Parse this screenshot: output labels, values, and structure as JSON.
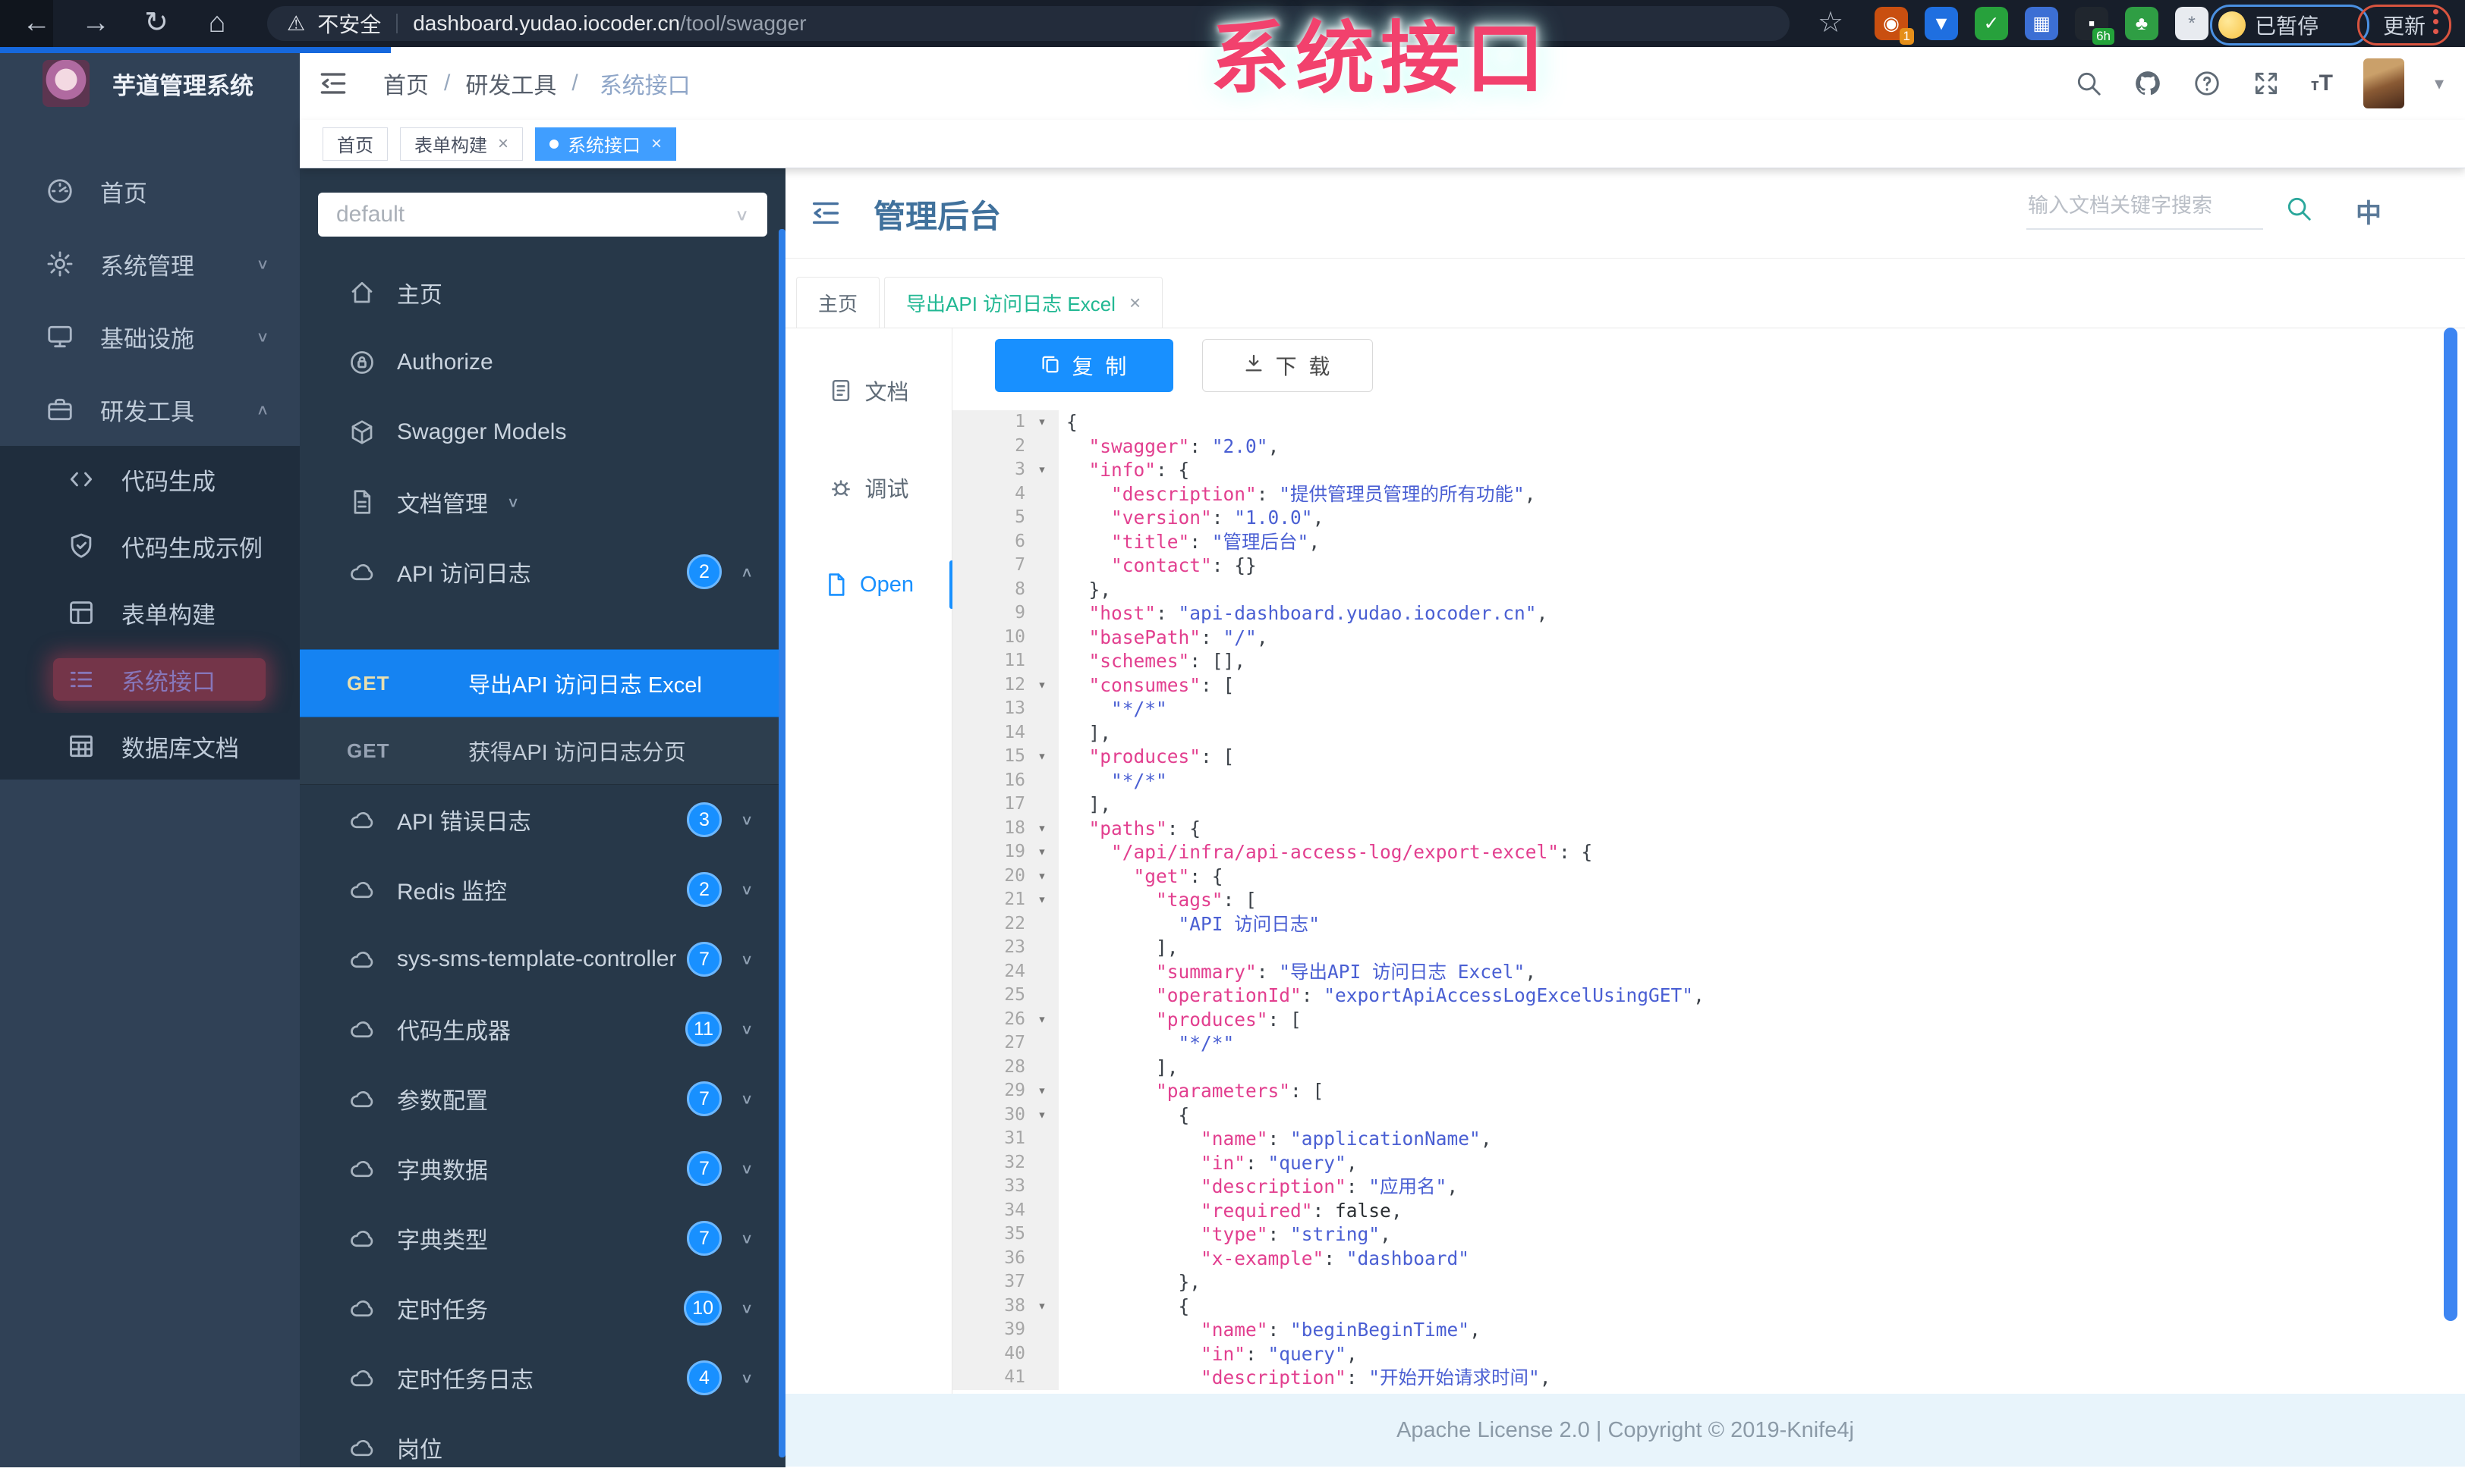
{
  "browser": {
    "security_label": "不安全",
    "url_host": "dashboard.yudao.iocoder.cn",
    "url_path": "/tool/swagger",
    "paused_label": "已暂停",
    "update_label": "更新",
    "extensions": [
      {
        "name": "circle-orange",
        "glyph": "◉",
        "bg": "#c94f10",
        "badge": "1",
        "badge_bg": "#e58f1a"
      },
      {
        "name": "pin-blue",
        "glyph": "▼",
        "bg": "#1f6fe0"
      },
      {
        "name": "check-green",
        "glyph": "✓",
        "bg": "#27a13c"
      },
      {
        "name": "grid-blue",
        "glyph": "▦",
        "bg": "#3c6fd4"
      },
      {
        "name": "timer-dark",
        "glyph": "▪",
        "bg": "#20262e",
        "badge": "6h",
        "badge_bg": "#23a33a"
      },
      {
        "name": "leaf-green",
        "glyph": "♣",
        "bg": "#2f9e44"
      },
      {
        "name": "star-light",
        "glyph": "*",
        "bg": "#e8ebf0",
        "fg": "#7c8694"
      }
    ]
  },
  "watermark": "系统接口",
  "sidebar": {
    "logo_title": "芋道管理系统",
    "items": [
      {
        "key": "home",
        "icon": "dashboard-icon",
        "label": "首页"
      },
      {
        "key": "system",
        "icon": "gear-icon",
        "label": "系统管理",
        "chevron": "down"
      },
      {
        "key": "infra",
        "icon": "infra-icon",
        "label": "基础设施",
        "chevron": "down"
      },
      {
        "key": "devtools",
        "icon": "tools-icon",
        "label": "研发工具",
        "chevron": "up"
      },
      {
        "key": "codegen",
        "icon": "code-icon",
        "label": "代码生成",
        "sub": true
      },
      {
        "key": "codegen-demo",
        "icon": "shield-icon",
        "label": "代码生成示例",
        "sub": true
      },
      {
        "key": "form-builder",
        "icon": "form-icon",
        "label": "表单构建",
        "sub": true
      },
      {
        "key": "system-api",
        "icon": "api-icon",
        "label": "系统接口",
        "sub": true,
        "active": true,
        "annotated": true
      },
      {
        "key": "db-doc",
        "icon": "db-icon",
        "label": "数据库文档",
        "sub": true
      }
    ]
  },
  "header": {
    "breadcrumb": [
      {
        "label": "首页"
      },
      {
        "label": "研发工具"
      },
      {
        "label": "系统接口",
        "current": true
      }
    ]
  },
  "tags": [
    {
      "key": "home",
      "label": "首页"
    },
    {
      "key": "form-builder",
      "label": "表单构建",
      "closable": true
    },
    {
      "key": "system-api",
      "label": "系统接口",
      "closable": true,
      "active": true
    }
  ],
  "swagger_panel": {
    "group_value": "default",
    "menu": [
      {
        "type": "item",
        "key": "home",
        "icon": "home-icon",
        "label": "主页"
      },
      {
        "type": "item",
        "key": "authorize",
        "icon": "lock-icon",
        "label": "Authorize"
      },
      {
        "type": "item",
        "key": "swagger-models",
        "icon": "models-icon",
        "label": "Swagger Models"
      },
      {
        "type": "item",
        "key": "doc-manage",
        "icon": "filedoc-icon",
        "label": "文档管理",
        "chevron": "down"
      },
      {
        "type": "item",
        "key": "api-access-log",
        "icon": "cloud-icon",
        "label": "API 访问日志",
        "badge": "2",
        "chevron": "up"
      },
      {
        "type": "api",
        "key": "export-excel",
        "method": "GET",
        "label": "导出API 访问日志 Excel",
        "active": true
      },
      {
        "type": "api",
        "key": "access-log-page",
        "method": "GET",
        "label": "获得API 访问日志分页"
      },
      {
        "type": "item",
        "key": "api-error-log",
        "icon": "cloud-icon",
        "label": "API 错误日志",
        "badge": "3",
        "chevron": "down"
      },
      {
        "type": "item",
        "key": "redis-monitor",
        "icon": "cloud-icon",
        "label": "Redis 监控",
        "badge": "2",
        "chevron": "down"
      },
      {
        "type": "item",
        "key": "sms-template",
        "icon": "cloud-icon",
        "label": "sys-sms-template-controller",
        "badge": "7",
        "chevron": "down"
      },
      {
        "type": "item",
        "key": "code-generator",
        "icon": "cloud-icon",
        "label": "代码生成器",
        "badge": "11",
        "chevron": "down"
      },
      {
        "type": "item",
        "key": "param-config",
        "icon": "cloud-icon",
        "label": "参数配置",
        "badge": "7",
        "chevron": "down"
      },
      {
        "type": "item",
        "key": "dict-data",
        "icon": "cloud-icon",
        "label": "字典数据",
        "badge": "7",
        "chevron": "down"
      },
      {
        "type": "item",
        "key": "dict-type",
        "icon": "cloud-icon",
        "label": "字典类型",
        "badge": "7",
        "chevron": "down"
      },
      {
        "type": "item",
        "key": "job",
        "icon": "cloud-icon",
        "label": "定时任务",
        "badge": "10",
        "chevron": "down"
      },
      {
        "type": "item",
        "key": "job-log",
        "icon": "cloud-icon",
        "label": "定时任务日志",
        "badge": "4",
        "chevron": "down"
      },
      {
        "type": "item",
        "key": "post",
        "icon": "cloud-icon",
        "label": "岗位",
        "partial": true
      }
    ]
  },
  "doc": {
    "title": "管理后台",
    "search_placeholder": "输入文档关键字搜索",
    "lang_icon_label": "中",
    "tabs": [
      {
        "key": "home",
        "label": "主页"
      },
      {
        "key": "export-excel",
        "label": "导出API 访问日志 Excel",
        "closable": true,
        "active": true
      }
    ],
    "subnav": [
      {
        "key": "document",
        "icon": "doc-icon",
        "label": "文档"
      },
      {
        "key": "debug",
        "icon": "bug-icon",
        "label": "调试"
      },
      {
        "key": "open",
        "icon": "file-icon",
        "label": "Open",
        "active": true
      }
    ],
    "toolbar": {
      "copy": "复 制",
      "download": "下 载"
    },
    "footer": "Apache License 2.0 | Copyright © 2019-Knife4j"
  },
  "code": {
    "lines": [
      {
        "n": 1,
        "f": 1,
        "t": [
          [
            "p",
            "{"
          ]
        ]
      },
      {
        "n": 2,
        "t": [
          [
            "p",
            "  "
          ],
          [
            "k",
            "\"swagger\""
          ],
          [
            "p",
            ": "
          ],
          [
            "s",
            "\"2.0\""
          ],
          [
            "p",
            ","
          ]
        ]
      },
      {
        "n": 3,
        "f": 1,
        "t": [
          [
            "p",
            "  "
          ],
          [
            "k",
            "\"info\""
          ],
          [
            "p",
            ": {"
          ]
        ]
      },
      {
        "n": 4,
        "t": [
          [
            "p",
            "    "
          ],
          [
            "k",
            "\"description\""
          ],
          [
            "p",
            ": "
          ],
          [
            "s",
            "\"提供管理员管理的所有功能\""
          ],
          [
            "p",
            ","
          ]
        ]
      },
      {
        "n": 5,
        "t": [
          [
            "p",
            "    "
          ],
          [
            "k",
            "\"version\""
          ],
          [
            "p",
            ": "
          ],
          [
            "s",
            "\"1.0.0\""
          ],
          [
            "p",
            ","
          ]
        ]
      },
      {
        "n": 6,
        "t": [
          [
            "p",
            "    "
          ],
          [
            "k",
            "\"title\""
          ],
          [
            "p",
            ": "
          ],
          [
            "s",
            "\"管理后台\""
          ],
          [
            "p",
            ","
          ]
        ]
      },
      {
        "n": 7,
        "t": [
          [
            "p",
            "    "
          ],
          [
            "k",
            "\"contact\""
          ],
          [
            "p",
            ": {}"
          ]
        ]
      },
      {
        "n": 8,
        "t": [
          [
            "p",
            "  },"
          ]
        ]
      },
      {
        "n": 9,
        "t": [
          [
            "p",
            "  "
          ],
          [
            "k",
            "\"host\""
          ],
          [
            "p",
            ": "
          ],
          [
            "s",
            "\"api-dashboard.yudao.iocoder.cn\""
          ],
          [
            "p",
            ","
          ]
        ]
      },
      {
        "n": 10,
        "t": [
          [
            "p",
            "  "
          ],
          [
            "k",
            "\"basePath\""
          ],
          [
            "p",
            ": "
          ],
          [
            "s",
            "\"/\""
          ],
          [
            "p",
            ","
          ]
        ]
      },
      {
        "n": 11,
        "t": [
          [
            "p",
            "  "
          ],
          [
            "k",
            "\"schemes\""
          ],
          [
            "p",
            ": [],"
          ]
        ]
      },
      {
        "n": 12,
        "f": 1,
        "t": [
          [
            "p",
            "  "
          ],
          [
            "k",
            "\"consumes\""
          ],
          [
            "p",
            ": ["
          ]
        ]
      },
      {
        "n": 13,
        "t": [
          [
            "p",
            "    "
          ],
          [
            "s",
            "\"*/*\""
          ]
        ]
      },
      {
        "n": 14,
        "t": [
          [
            "p",
            "  ],"
          ]
        ]
      },
      {
        "n": 15,
        "f": 1,
        "t": [
          [
            "p",
            "  "
          ],
          [
            "k",
            "\"produces\""
          ],
          [
            "p",
            ": ["
          ]
        ]
      },
      {
        "n": 16,
        "t": [
          [
            "p",
            "    "
          ],
          [
            "s",
            "\"*/*\""
          ]
        ]
      },
      {
        "n": 17,
        "t": [
          [
            "p",
            "  ],"
          ]
        ]
      },
      {
        "n": 18,
        "f": 1,
        "t": [
          [
            "p",
            "  "
          ],
          [
            "k",
            "\"paths\""
          ],
          [
            "p",
            ": {"
          ]
        ]
      },
      {
        "n": 19,
        "f": 1,
        "t": [
          [
            "p",
            "    "
          ],
          [
            "k",
            "\"/api/infra/api-access-log/export-excel\""
          ],
          [
            "p",
            ": {"
          ]
        ]
      },
      {
        "n": 20,
        "f": 1,
        "t": [
          [
            "p",
            "      "
          ],
          [
            "k",
            "\"get\""
          ],
          [
            "p",
            ": {"
          ]
        ]
      },
      {
        "n": 21,
        "f": 1,
        "t": [
          [
            "p",
            "        "
          ],
          [
            "k",
            "\"tags\""
          ],
          [
            "p",
            ": ["
          ]
        ]
      },
      {
        "n": 22,
        "t": [
          [
            "p",
            "          "
          ],
          [
            "s",
            "\"API 访问日志\""
          ]
        ]
      },
      {
        "n": 23,
        "t": [
          [
            "p",
            "        ],"
          ]
        ]
      },
      {
        "n": 24,
        "t": [
          [
            "p",
            "        "
          ],
          [
            "k",
            "\"summary\""
          ],
          [
            "p",
            ": "
          ],
          [
            "s",
            "\"导出API 访问日志 Excel\""
          ],
          [
            "p",
            ","
          ]
        ]
      },
      {
        "n": 25,
        "t": [
          [
            "p",
            "        "
          ],
          [
            "k",
            "\"operationId\""
          ],
          [
            "p",
            ": "
          ],
          [
            "s",
            "\"exportApiAccessLogExcelUsingGET\""
          ],
          [
            "p",
            ","
          ]
        ]
      },
      {
        "n": 26,
        "f": 1,
        "t": [
          [
            "p",
            "        "
          ],
          [
            "k",
            "\"produces\""
          ],
          [
            "p",
            ": ["
          ]
        ]
      },
      {
        "n": 27,
        "t": [
          [
            "p",
            "          "
          ],
          [
            "s",
            "\"*/*\""
          ]
        ]
      },
      {
        "n": 28,
        "t": [
          [
            "p",
            "        ],"
          ]
        ]
      },
      {
        "n": 29,
        "f": 1,
        "t": [
          [
            "p",
            "        "
          ],
          [
            "k",
            "\"parameters\""
          ],
          [
            "p",
            ": ["
          ]
        ]
      },
      {
        "n": 30,
        "f": 1,
        "t": [
          [
            "p",
            "          {"
          ]
        ]
      },
      {
        "n": 31,
        "t": [
          [
            "p",
            "            "
          ],
          [
            "k",
            "\"name\""
          ],
          [
            "p",
            ": "
          ],
          [
            "s",
            "\"applicationName\""
          ],
          [
            "p",
            ","
          ]
        ]
      },
      {
        "n": 32,
        "t": [
          [
            "p",
            "            "
          ],
          [
            "k",
            "\"in\""
          ],
          [
            "p",
            ": "
          ],
          [
            "s",
            "\"query\""
          ],
          [
            "p",
            ","
          ]
        ]
      },
      {
        "n": 33,
        "t": [
          [
            "p",
            "            "
          ],
          [
            "k",
            "\"description\""
          ],
          [
            "p",
            ": "
          ],
          [
            "s",
            "\"应用名\""
          ],
          [
            "p",
            ","
          ]
        ]
      },
      {
        "n": 34,
        "t": [
          [
            "p",
            "            "
          ],
          [
            "k",
            "\"required\""
          ],
          [
            "p",
            ": "
          ],
          [
            "b",
            "false"
          ],
          [
            "p",
            ","
          ]
        ]
      },
      {
        "n": 35,
        "t": [
          [
            "p",
            "            "
          ],
          [
            "k",
            "\"type\""
          ],
          [
            "p",
            ": "
          ],
          [
            "s",
            "\"string\""
          ],
          [
            "p",
            ","
          ]
        ]
      },
      {
        "n": 36,
        "t": [
          [
            "p",
            "            "
          ],
          [
            "k",
            "\"x-example\""
          ],
          [
            "p",
            ": "
          ],
          [
            "s",
            "\"dashboard\""
          ]
        ]
      },
      {
        "n": 37,
        "t": [
          [
            "p",
            "          },"
          ]
        ]
      },
      {
        "n": 38,
        "f": 1,
        "t": [
          [
            "p",
            "          {"
          ]
        ]
      },
      {
        "n": 39,
        "t": [
          [
            "p",
            "            "
          ],
          [
            "k",
            "\"name\""
          ],
          [
            "p",
            ": "
          ],
          [
            "s",
            "\"beginBeginTime\""
          ],
          [
            "p",
            ","
          ]
        ]
      },
      {
        "n": 40,
        "t": [
          [
            "p",
            "            "
          ],
          [
            "k",
            "\"in\""
          ],
          [
            "p",
            ": "
          ],
          [
            "s",
            "\"query\""
          ],
          [
            "p",
            ","
          ]
        ]
      },
      {
        "n": 41,
        "t": [
          [
            "p",
            "            "
          ],
          [
            "k",
            "\"description\""
          ],
          [
            "p",
            ": "
          ],
          [
            "s",
            "\"开始开始请求时间\""
          ],
          [
            "p",
            ","
          ]
        ]
      }
    ]
  }
}
